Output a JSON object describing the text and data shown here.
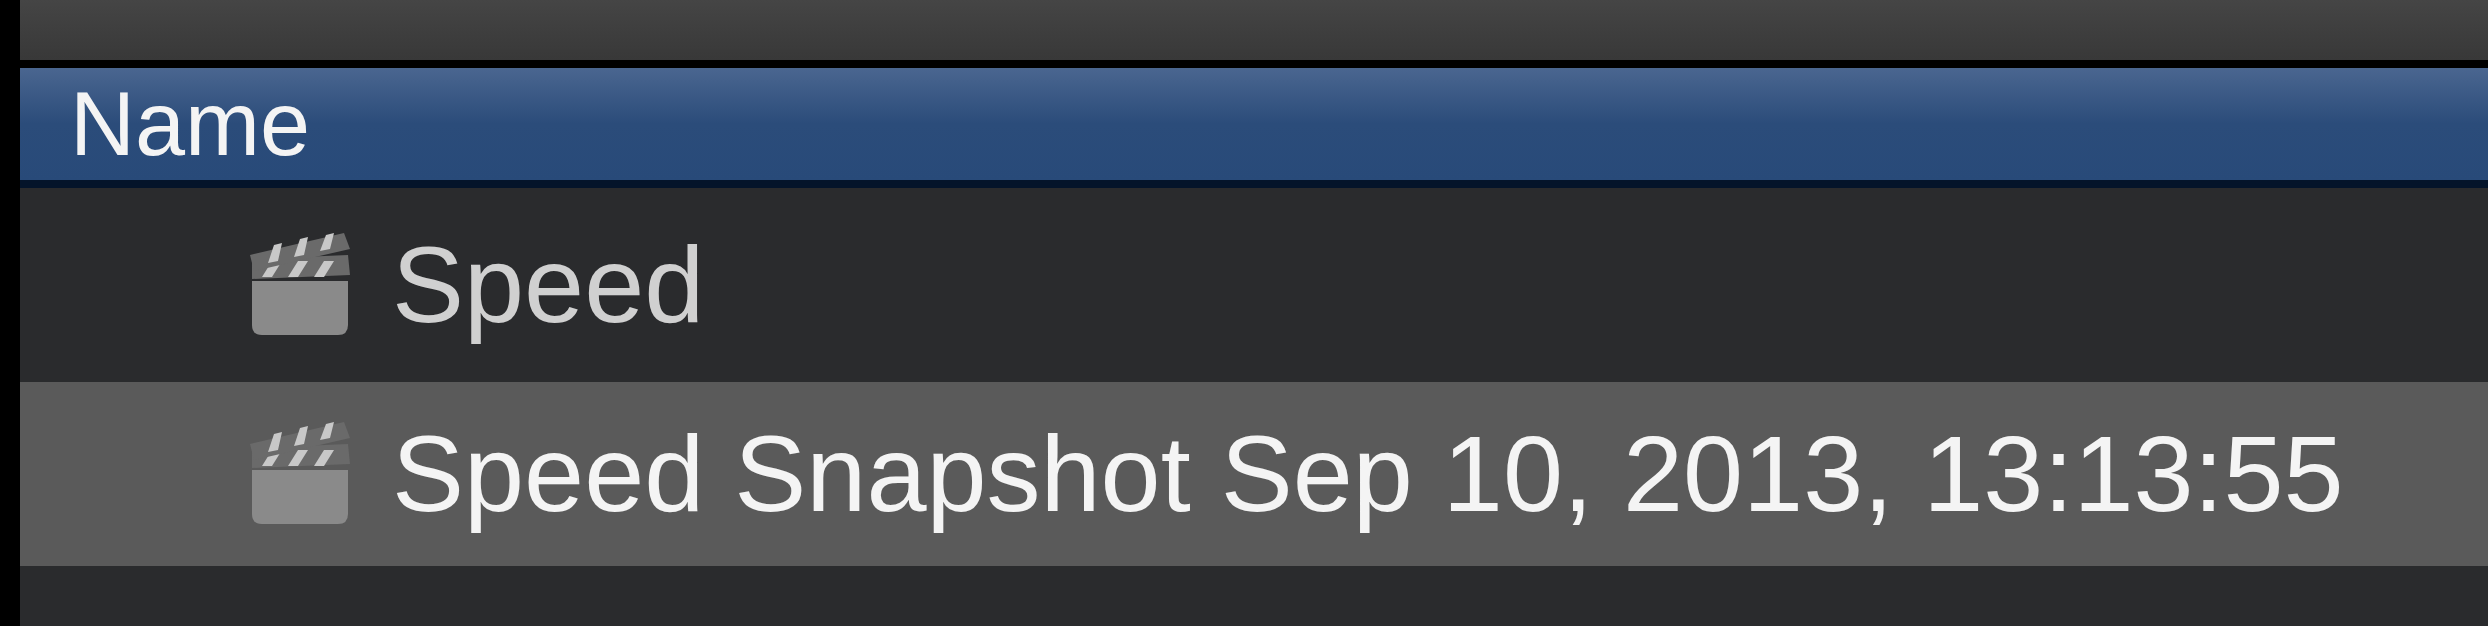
{
  "table": {
    "columns": [
      {
        "label": "Name"
      }
    ],
    "rows": [
      {
        "kind": "project",
        "name": "Speed",
        "selected": false
      },
      {
        "kind": "project",
        "name": "Speed Snapshot Sep 10, 2013, 13:13:55",
        "selected": true
      }
    ]
  }
}
